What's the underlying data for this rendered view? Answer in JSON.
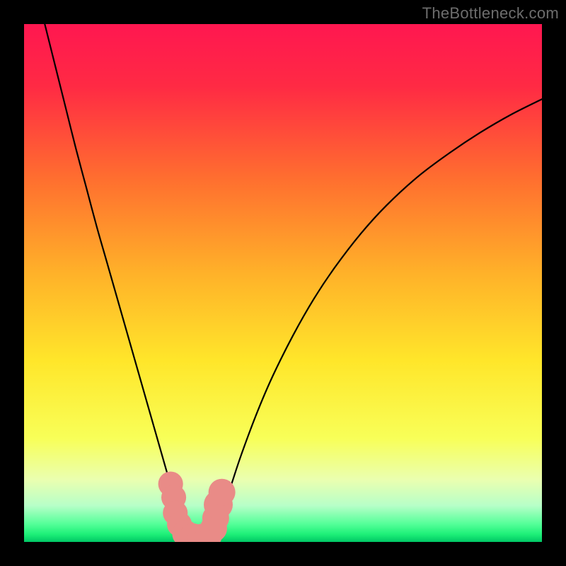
{
  "watermark": "TheBottleneck.com",
  "colors": {
    "frame": "#000000",
    "gradient_stops": [
      {
        "offset": 0.0,
        "color": "#ff1750"
      },
      {
        "offset": 0.12,
        "color": "#ff2a44"
      },
      {
        "offset": 0.3,
        "color": "#ff6f2f"
      },
      {
        "offset": 0.48,
        "color": "#ffb129"
      },
      {
        "offset": 0.65,
        "color": "#ffe62a"
      },
      {
        "offset": 0.8,
        "color": "#f8ff58"
      },
      {
        "offset": 0.88,
        "color": "#eaffb0"
      },
      {
        "offset": 0.93,
        "color": "#b7ffc8"
      },
      {
        "offset": 0.965,
        "color": "#55ff99"
      },
      {
        "offset": 0.985,
        "color": "#1ef078"
      },
      {
        "offset": 1.0,
        "color": "#00c765"
      }
    ],
    "curve": "#000000",
    "marker_fill": "#e98b87",
    "marker_stroke": "#e98b87"
  },
  "chart_data": {
    "type": "line",
    "title": "",
    "xlabel": "",
    "ylabel": "",
    "xlim": [
      0,
      100
    ],
    "ylim": [
      0,
      100
    ],
    "series": [
      {
        "name": "left-branch",
        "x": [
          4,
          6,
          8,
          10,
          12,
          14,
          16,
          18,
          20,
          22,
          24,
          25,
          26,
          27,
          28,
          29,
          30,
          31
        ],
        "y": [
          100,
          92,
          84,
          76,
          68.5,
          61,
          54,
          47,
          40,
          33,
          26,
          22.5,
          19,
          15.5,
          12,
          8.5,
          5,
          2
        ]
      },
      {
        "name": "right-branch",
        "x": [
          37,
          38,
          40,
          42,
          45,
          48,
          52,
          56,
          60,
          65,
          70,
          76,
          82,
          88,
          94,
          100
        ],
        "y": [
          2,
          5,
          11,
          17,
          25,
          32,
          40,
          47,
          53,
          59.5,
          65,
          70.5,
          75,
          79,
          82.5,
          85.5
        ]
      }
    ],
    "floor_segment": {
      "x0": 31,
      "x1": 37,
      "y": 0.8
    },
    "markers": [
      {
        "x": 28.3,
        "y": 11.2,
        "r": 2.4
      },
      {
        "x": 28.9,
        "y": 8.6,
        "r": 2.4
      },
      {
        "x": 29.2,
        "y": 5.6,
        "r": 2.4
      },
      {
        "x": 30.0,
        "y": 3.4,
        "r": 2.4
      },
      {
        "x": 31.2,
        "y": 1.6,
        "r": 2.6
      },
      {
        "x": 32.6,
        "y": 1.0,
        "r": 2.6
      },
      {
        "x": 34.2,
        "y": 0.9,
        "r": 2.6
      },
      {
        "x": 35.6,
        "y": 1.2,
        "r": 2.6
      },
      {
        "x": 36.6,
        "y": 2.6,
        "r": 2.6
      },
      {
        "x": 37.0,
        "y": 4.6,
        "r": 2.6
      },
      {
        "x": 37.5,
        "y": 7.2,
        "r": 2.8
      },
      {
        "x": 38.2,
        "y": 9.6,
        "r": 2.6
      }
    ]
  }
}
